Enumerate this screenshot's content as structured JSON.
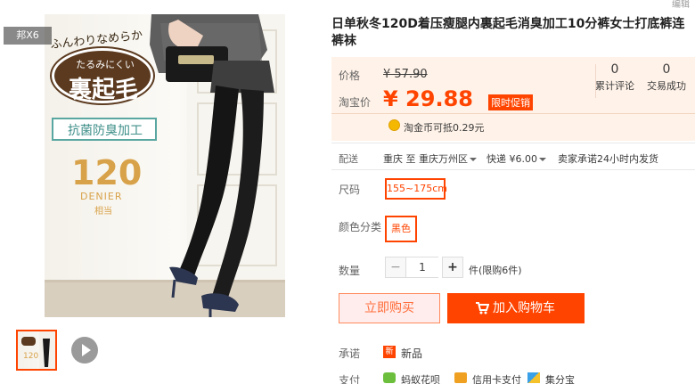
{
  "gallery": {
    "badge_top": "ふんわりなめらか",
    "badge_mid": "たるみにくい",
    "badge_main": "裏起毛",
    "badge_sub": "抗菌防臭加工",
    "denier_value": "120",
    "denier_unit": "DENIER",
    "denier_note": "相当",
    "thumb_overlay": "邦X6"
  },
  "corner": {
    "edit_label": "编辑"
  },
  "product": {
    "title": "日单秋冬120D着压瘦腿内裏起毛消臭加工10分裤女士打底裤连裤袜"
  },
  "price": {
    "original_label": "价格",
    "original_value": "¥ 57.90",
    "promo_label": "淘宝价",
    "promo_value": "¥ 29.88",
    "promo_tag": "限时促销",
    "coin_text": "淘金币可抵0.29元",
    "stats": [
      {
        "num": "0",
        "label": "累计评论"
      },
      {
        "num": "0",
        "label": "交易成功"
      }
    ]
  },
  "shipping": {
    "label": "配送",
    "from": "重庆 至",
    "to": "重庆万州区",
    "method": "快递",
    "fee": "¥6.00",
    "promise": "卖家承诺24小时内发货"
  },
  "sku": {
    "size_label": "尺码",
    "size_value": "155~175cm",
    "color_label": "颜色分类",
    "color_value": "黑色"
  },
  "quantity": {
    "label": "数量",
    "minus": "−",
    "value": "1",
    "plus": "+",
    "unit": "件(限购6件)"
  },
  "actions": {
    "buy_now": "立即购买",
    "add_cart": "加入购物车"
  },
  "service": {
    "promise_label": "承诺",
    "promise_badge": "新",
    "promise_text": "新品",
    "pay_label": "支付",
    "pay_methods": [
      "蚂蚁花呗",
      "信用卡支付",
      "集分宝"
    ]
  },
  "colors": {
    "accent": "#ff4400",
    "price_bg": "#fff2e8",
    "buy_bg": "#ffeded"
  }
}
